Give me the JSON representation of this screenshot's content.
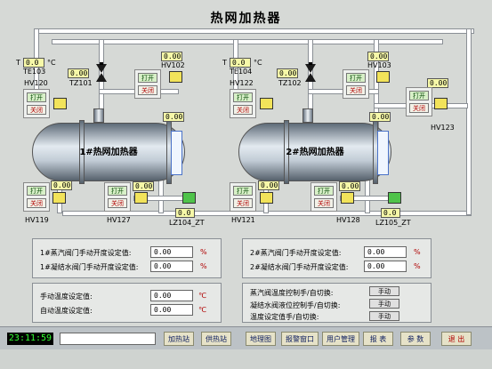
{
  "title": "热网加热器",
  "tanks": [
    {
      "name": "1#热网加热器"
    },
    {
      "name": "2#热网加热器"
    }
  ],
  "tags": {
    "te103": "TE103",
    "te104": "TE104",
    "hv120": "HV120",
    "hv122": "HV122",
    "tz101": "TZ101",
    "tz102": "TZ102",
    "hv102": "HV102",
    "hv103": "HV103",
    "hv123": "HV123",
    "hv119": "HV119",
    "hv127": "HV127",
    "lz104": "LZ104_ZT",
    "hv121": "HV121",
    "hv128": "HV128",
    "lz105": "LZ105_ZT",
    "t_label": "T",
    "celsius": "°C"
  },
  "values": {
    "te103": "0.0",
    "te104": "0.0",
    "tz101": "0.00",
    "tz102": "0.00",
    "hv102": "0.00",
    "hv103": "0.00",
    "hv123": "0.00",
    "tank1_top": "0.00",
    "tank2_top": "0.00",
    "hv119": "0.00",
    "hv127": "0.00",
    "lz104": "0.0",
    "hv121": "0.00",
    "hv128": "0.00",
    "lz105": "0.0"
  },
  "buttons": {
    "open": "打开",
    "close": "关闭"
  },
  "setpoints": {
    "steam1_label": "1#蒸汽阀门手动开度设定值:",
    "cond1_label": "1#凝结水阀门手动开度设定值:",
    "steam2_label": "2#蒸汽阀门手动开度设定值:",
    "cond2_label": "2#凝结水阀门手动开度设定值:",
    "steam1": "0.00",
    "cond1": "0.00",
    "steam2": "0.00",
    "cond2": "0.00",
    "percent": "%",
    "manual_temp_label": "手动温度设定值:",
    "auto_temp_label": "自动温度设定值:",
    "manual_temp": "0.00",
    "auto_temp": "0.00",
    "temp_unit": "℃"
  },
  "modes": {
    "steam_valve_temp_label": "蒸汽阀温度控制手/自切换:",
    "cond_valve_level_label": "凝结水阀液位控制手/自切换:",
    "temp_setpoint_label": "温度设定值手/自切换:",
    "manual": "手动"
  },
  "statusbar": {
    "clock": "23:11:59",
    "nav": [
      "加热站",
      "供热站",
      "地理图",
      "报警窗口",
      "用户管理",
      "报 表",
      "参 数",
      "退 出"
    ]
  }
}
